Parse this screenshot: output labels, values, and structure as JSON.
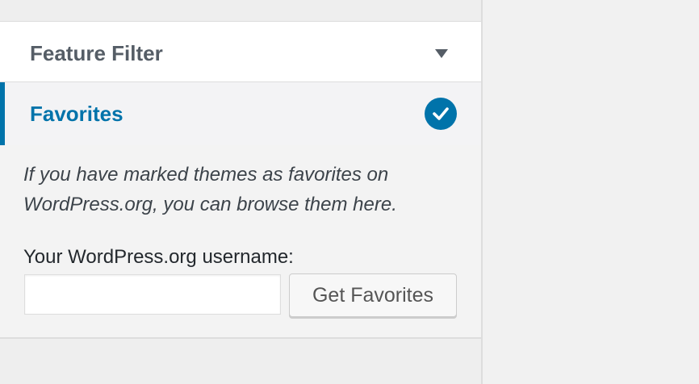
{
  "feature_filter": {
    "label": "Feature Filter",
    "icon": "chevron-down-icon"
  },
  "favorites": {
    "label": "Favorites",
    "icon": "checkmark-circle-icon",
    "selected": true,
    "description": "If you have marked themes as favorites on WordPress.org, you can browse them here.",
    "username_label": "Your WordPress.org username:",
    "username_value": "",
    "username_placeholder": "",
    "button_label": "Get Favorites"
  },
  "colors": {
    "accent": "#0073aa",
    "text_dark": "#555d66"
  }
}
